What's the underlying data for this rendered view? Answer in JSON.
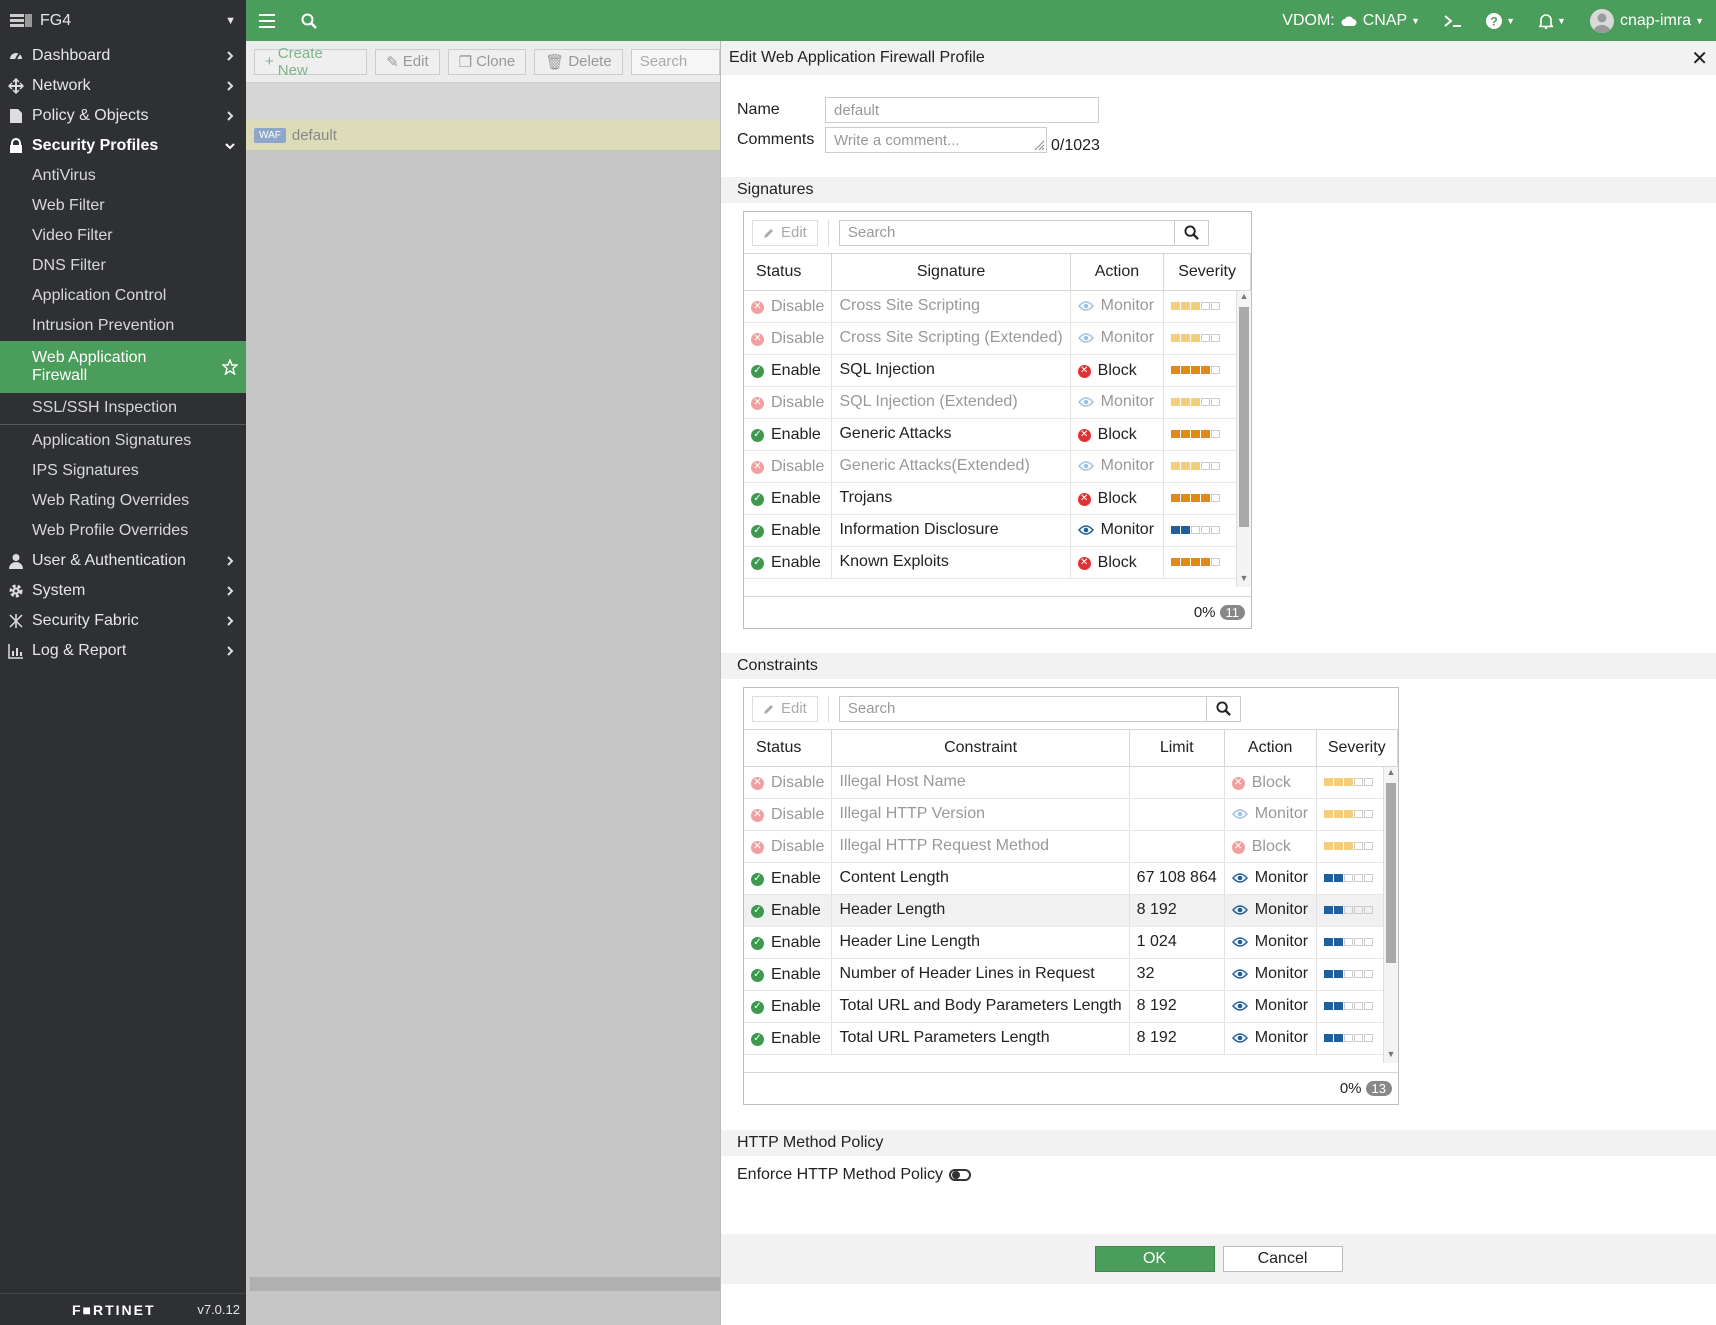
{
  "sidebar": {
    "device_name": "FG4",
    "items": [
      {
        "label": "Dashboard"
      },
      {
        "label": "Network"
      },
      {
        "label": "Policy & Objects"
      },
      {
        "label": "Security Profiles"
      }
    ],
    "security_profiles": [
      {
        "label": "AntiVirus"
      },
      {
        "label": "Web Filter"
      },
      {
        "label": "Video Filter"
      },
      {
        "label": "DNS Filter"
      },
      {
        "label": "Application Control"
      },
      {
        "label": "Intrusion Prevention"
      },
      {
        "label": "Web Application Firewall"
      },
      {
        "label": "SSL/SSH Inspection"
      },
      {
        "label": "Application Signatures"
      },
      {
        "label": "IPS Signatures"
      },
      {
        "label": "Web Rating Overrides"
      },
      {
        "label": "Web Profile Overrides"
      }
    ],
    "items_after": [
      {
        "label": "User & Authentication"
      },
      {
        "label": "System"
      },
      {
        "label": "Security Fabric"
      },
      {
        "label": "Log & Report"
      }
    ],
    "brand": "F■RTINET",
    "version": "v7.0.12"
  },
  "topbar": {
    "vdom_label": "VDOM:",
    "vdom_value": "CNAP",
    "user": "cnap-imra"
  },
  "list_toolbar": {
    "create_new": "Create New",
    "edit": "Edit",
    "clone": "Clone",
    "delete": "Delete",
    "search_placeholder": "Search"
  },
  "list": {
    "badge": "WAF",
    "profile_name": "default"
  },
  "dialog": {
    "title": "Edit Web Application Firewall Profile",
    "name_label": "Name",
    "name_value": "default",
    "comments_label": "Comments",
    "comments_placeholder": "Write a comment...",
    "comments_count": "0/1023",
    "signatures_heading": "Signatures",
    "constraints_heading": "Constraints",
    "http_heading": "HTTP Method Policy",
    "enforce_label": "Enforce HTTP Method Policy",
    "ok_label": "OK",
    "cancel_label": "Cancel"
  },
  "signatures": {
    "edit_label": "Edit",
    "search_placeholder": "Search",
    "columns": [
      "Status",
      "Signature",
      "Action",
      "Severity"
    ],
    "rows": [
      {
        "status": "Disable",
        "signature": "Cross Site Scripting",
        "action": "Monitor",
        "severity": 3,
        "level": "medium"
      },
      {
        "status": "Disable",
        "signature": "Cross Site Scripting (Extended)",
        "action": "Monitor",
        "severity": 3,
        "level": "medium"
      },
      {
        "status": "Enable",
        "signature": "SQL Injection",
        "action": "Block",
        "severity": 4,
        "level": "high"
      },
      {
        "status": "Disable",
        "signature": "SQL Injection (Extended)",
        "action": "Monitor",
        "severity": 3,
        "level": "medium"
      },
      {
        "status": "Enable",
        "signature": "Generic Attacks",
        "action": "Block",
        "severity": 4,
        "level": "high"
      },
      {
        "status": "Disable",
        "signature": "Generic Attacks(Extended)",
        "action": "Monitor",
        "severity": 3,
        "level": "medium"
      },
      {
        "status": "Enable",
        "signature": "Trojans",
        "action": "Block",
        "severity": 4,
        "level": "high"
      },
      {
        "status": "Enable",
        "signature": "Information Disclosure",
        "action": "Monitor",
        "severity": 2,
        "level": "low"
      },
      {
        "status": "Enable",
        "signature": "Known Exploits",
        "action": "Block",
        "severity": 4,
        "level": "high"
      }
    ],
    "footer_percent": "0%",
    "footer_count": "11"
  },
  "constraints": {
    "edit_label": "Edit",
    "search_placeholder": "Search",
    "columns": [
      "Status",
      "Constraint",
      "Limit",
      "Action",
      "Severity"
    ],
    "rows": [
      {
        "status": "Disable",
        "constraint": "Illegal Host Name",
        "limit": "",
        "action": "Block",
        "severity": 3,
        "level": "medium"
      },
      {
        "status": "Disable",
        "constraint": "Illegal HTTP Version",
        "limit": "",
        "action": "Monitor",
        "severity": 3,
        "level": "medium"
      },
      {
        "status": "Disable",
        "constraint": "Illegal HTTP Request Method",
        "limit": "",
        "action": "Block",
        "severity": 3,
        "level": "medium"
      },
      {
        "status": "Enable",
        "constraint": "Content Length",
        "limit": "67 108 864",
        "action": "Monitor",
        "severity": 2,
        "level": "low"
      },
      {
        "status": "Enable",
        "constraint": "Header Length",
        "limit": "8 192",
        "action": "Monitor",
        "severity": 2,
        "level": "low"
      },
      {
        "status": "Enable",
        "constraint": "Header Line Length",
        "limit": "1 024",
        "action": "Monitor",
        "severity": 2,
        "level": "low"
      },
      {
        "status": "Enable",
        "constraint": "Number of Header Lines in Request",
        "limit": "32",
        "action": "Monitor",
        "severity": 2,
        "level": "low"
      },
      {
        "status": "Enable",
        "constraint": "Total URL and Body Parameters Length",
        "limit": "8 192",
        "action": "Monitor",
        "severity": 2,
        "level": "low"
      },
      {
        "status": "Enable",
        "constraint": "Total URL Parameters Length",
        "limit": "8 192",
        "action": "Monitor",
        "severity": 2,
        "level": "low"
      }
    ],
    "footer_percent": "0%",
    "footer_count": "13"
  },
  "colors": {
    "brand_green": "#4a9d5b",
    "sidebar_bg": "#2e3033",
    "severity_high": "#e08a1e",
    "severity_medium": "#f3cf7a",
    "severity_low": "#1f5f9e"
  }
}
